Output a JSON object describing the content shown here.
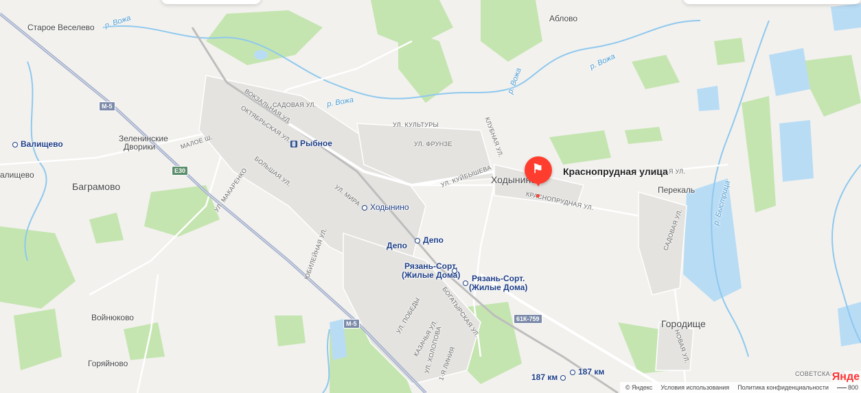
{
  "map": {
    "pin_label": "Краснопрудная улица",
    "towns": {
      "bagramovo": "Баграмово",
      "khodynino": "Ходынино",
      "gorodishche": "Городище",
      "perekal": "Перекаль",
      "voynyukovo": "Войнюково",
      "goryainovo": "Горяйново",
      "ablovo": "Аблово",
      "staroe_veselevo": "Старое Веселево",
      "zeleninskie_1": "Зеленинские",
      "zeleninskie_2": "Дворики",
      "valishchevo_left": "алищево"
    },
    "stations": {
      "valishchevo": "Валищево",
      "rybnoe": "Рыбное",
      "khodynino": "Ходынино",
      "depo_left": "Депо",
      "depo_right": "Депо",
      "ryazan_sort_1a": "Рязань-Сорт.",
      "ryazan_sort_1b": "(Жилые Дома)",
      "ryazan_sort_2a": "Рязань-Сорт.",
      "ryazan_sort_2b": "(Жилые Дома)",
      "km187_left": "187 км",
      "km187_right": "187 км"
    },
    "streets": {
      "vokzalnaya": "Вокзальная ул.",
      "sadovaya": "Садовая ул.",
      "oktyabrskaya": "Октябрьская ул.",
      "maloe": "Малое ш.",
      "bolshaya": "Большая ул.",
      "makarenko": "ул. Макаренко",
      "mira": "ул. Мира",
      "yubileynaya": "Юбилейная ул.",
      "kultury": "ул. Культуры",
      "frunze": "ул. Фрунзе",
      "kuybysheva": "ул. Куйбышева",
      "klubnaya": "Клубная ул.",
      "krasnoprudnaya": "Краснопрудная ул.",
      "sadovaya_2": "Садовая ул.",
      "novaya": "Новая ул.",
      "pobedy": "ул. Победы",
      "bogatyrskaya": "Богатырская ул.",
      "kazachya": "Казачья ул.",
      "kholopova": "ул. Холопова",
      "line1": "1-я линия",
      "sovetskaya": "Советская ул",
      "naya_fragment": "зная ул."
    },
    "rivers": {
      "vozha_1": "р. Вожа",
      "vozha_2": "р. Вожа",
      "vozha_3": "р. Вожа",
      "vozha_4": "р. Вожа",
      "bystritsa": "р. Быстрица"
    },
    "roads": {
      "m5_top": "M-5",
      "m5_bottom": "M-5",
      "e30": "E30",
      "r61k": "61К-759"
    }
  },
  "footer": {
    "copyright": "© Яндекс",
    "terms": "Условия использования",
    "privacy": "Политика конфиденциальности",
    "scale": "800",
    "logo": "Янде"
  }
}
